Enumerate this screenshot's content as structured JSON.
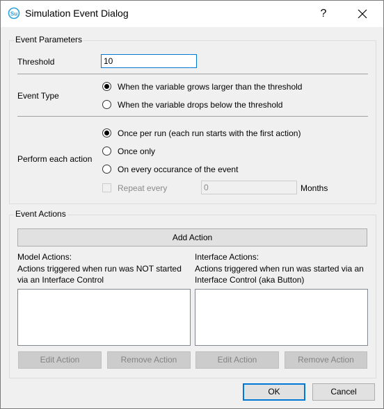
{
  "window": {
    "title": "Simulation Event Dialog",
    "help_label": "?",
    "app_icon": "su-logo-icon",
    "close_icon": "close-icon"
  },
  "event_parameters": {
    "group_title": "Event Parameters",
    "threshold_label": "Threshold",
    "threshold_value": "10",
    "event_type_label": "Event Type",
    "event_type_options": [
      {
        "label": "When the variable grows larger than the threshold",
        "selected": true
      },
      {
        "label": "When the variable drops below the threshold",
        "selected": false
      }
    ],
    "perform_label": "Perform each action",
    "perform_options": [
      {
        "label": "Once per run (each run starts with the first action)",
        "selected": true
      },
      {
        "label": "Once only",
        "selected": false
      },
      {
        "label": "On every occurance of the event",
        "selected": false
      }
    ],
    "repeat_label": "Repeat every",
    "repeat_value": "0",
    "repeat_unit": "Months"
  },
  "event_actions": {
    "group_title": "Event Actions",
    "add_action_label": "Add Action",
    "model_actions": {
      "title": "Model Actions:",
      "description": "Actions triggered when run was NOT started via an Interface Control",
      "edit_label": "Edit Action",
      "remove_label": "Remove Action"
    },
    "interface_actions": {
      "title": "Interface Actions:",
      "description": "Actions triggered when run was started via an Interface Control (aka Button)",
      "edit_label": "Edit Action",
      "remove_label": "Remove Action"
    }
  },
  "footer": {
    "ok_label": "OK",
    "cancel_label": "Cancel"
  },
  "colors": {
    "accent": "#0078d7",
    "dialog_bg": "#f0f0f0",
    "disabled_text": "#8a8a8a"
  }
}
